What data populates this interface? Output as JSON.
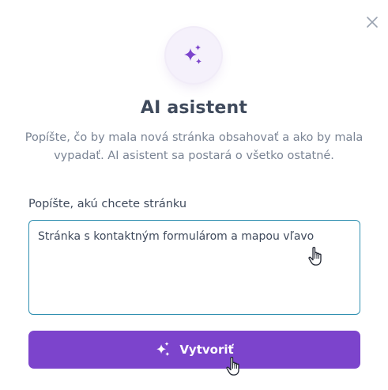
{
  "dialog": {
    "title": "AI asistent",
    "description": "Popíšte, čo by mala nová stránka obsahovať a ako by mala vypadať. AI asistent sa postará o všetko ostatné.",
    "close_icon": "close-icon",
    "header_icon": "sparkles-icon"
  },
  "prompt": {
    "label": "Popíšte, akú chcete stránku",
    "value": "Stránka s kontaktným formulárom a mapou vľavo"
  },
  "create_button": {
    "label": "Vytvoriť",
    "icon": "sparkles-icon"
  },
  "colors": {
    "accent": "#7c44cc",
    "input_border": "#2f8fb0",
    "title": "#3f4a5c",
    "description": "#7a8494",
    "halo": "#f5f1fb"
  }
}
